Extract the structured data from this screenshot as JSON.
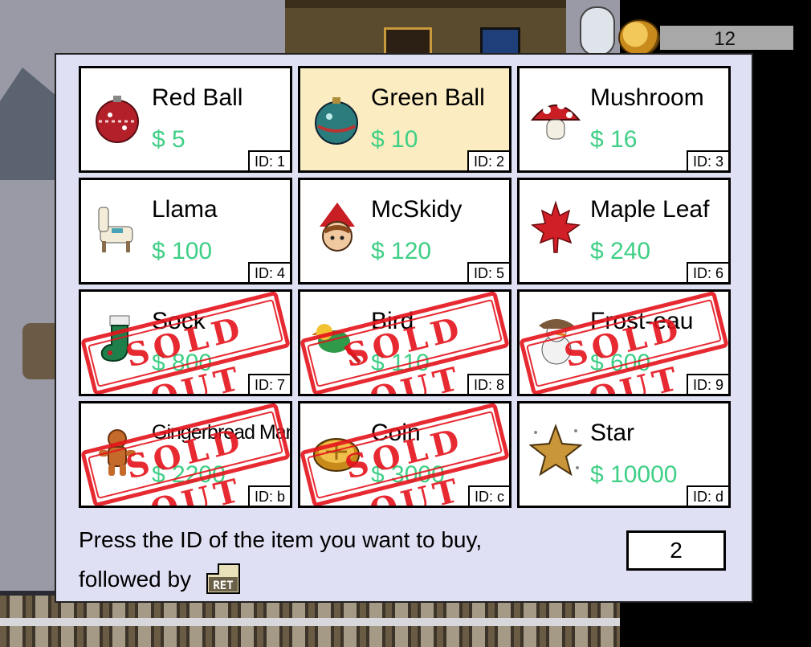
{
  "hud": {
    "coins": "12"
  },
  "shop": {
    "items": [
      {
        "name": "Red Ball",
        "price": "$ 5",
        "id": "ID: 1",
        "sold_out": false,
        "selected": false,
        "icon": "red-ornament-icon"
      },
      {
        "name": "Green Ball",
        "price": "$ 10",
        "id": "ID: 2",
        "sold_out": false,
        "selected": true,
        "icon": "green-ornament-icon"
      },
      {
        "name": "Mushroom",
        "price": "$ 16",
        "id": "ID: 3",
        "sold_out": false,
        "selected": false,
        "icon": "mushroom-icon"
      },
      {
        "name": "Llama",
        "price": "$ 100",
        "id": "ID: 4",
        "sold_out": false,
        "selected": false,
        "icon": "llama-icon"
      },
      {
        "name": "McSkidy",
        "price": "$ 120",
        "id": "ID: 5",
        "sold_out": false,
        "selected": false,
        "icon": "elf-icon"
      },
      {
        "name": "Maple Leaf",
        "price": "$ 240",
        "id": "ID: 6",
        "sold_out": false,
        "selected": false,
        "icon": "maple-leaf-icon"
      },
      {
        "name": "Sock",
        "price": "$ 800",
        "id": "ID: 7",
        "sold_out": true,
        "selected": false,
        "icon": "stocking-icon"
      },
      {
        "name": "Bird",
        "price": "$ 110",
        "id": "ID: 8",
        "sold_out": true,
        "selected": false,
        "icon": "bird-icon"
      },
      {
        "name": "Frost-eau",
        "price": "$ 600",
        "id": "ID: 9",
        "sold_out": true,
        "selected": false,
        "icon": "snowman-icon"
      },
      {
        "name": "Gingerbread Man",
        "price": "$ 2200",
        "id": "ID: b",
        "sold_out": true,
        "selected": false,
        "icon": "gingerbread-icon"
      },
      {
        "name": "Coin",
        "price": "$ 3000",
        "id": "ID: c",
        "sold_out": true,
        "selected": false,
        "icon": "coin-icon"
      },
      {
        "name": "Star",
        "price": "$ 10000",
        "id": "ID: d",
        "sold_out": false,
        "selected": false,
        "icon": "star-icon"
      }
    ],
    "sold_out_label": "SOLD OUT",
    "instructions_line1": "Press the ID of the item you want to buy,",
    "instructions_line2": "followed by",
    "ret_key_label": "RET",
    "entry_value": "2"
  },
  "colors": {
    "price": "#3fcf86",
    "sold_stamp": "#e5141c",
    "selected_card": "#fbedc1",
    "panel": "#e0e0f4"
  }
}
